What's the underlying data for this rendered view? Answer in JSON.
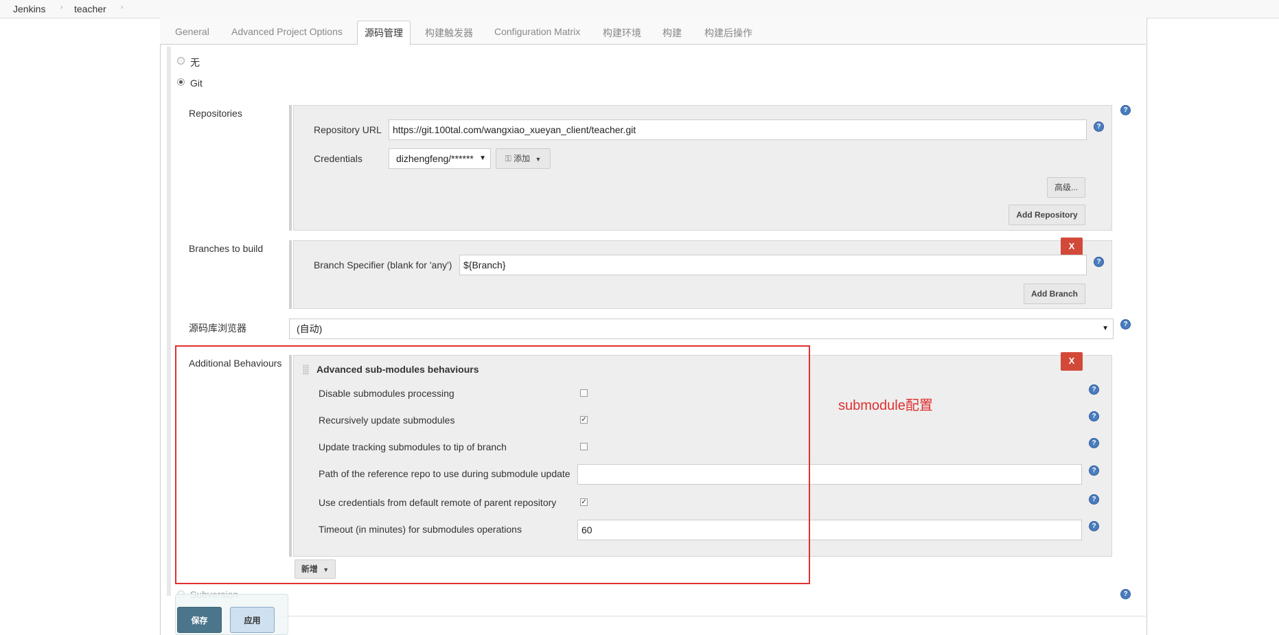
{
  "breadcrumb": [
    "Jenkins",
    "teacher"
  ],
  "tabs": [
    "General",
    "Advanced Project Options",
    "源码管理",
    "构建触发器",
    "Configuration Matrix",
    "构建环境",
    "构建",
    "构建后操作"
  ],
  "scm": {
    "option_none": "无",
    "option_git": "Git",
    "option_svn": "Subversion",
    "selected": "Git"
  },
  "repositories": {
    "label": "Repositories",
    "url_label": "Repository URL",
    "url_value": "https://git.100tal.com/wangxiao_xueyan_client/teacher.git",
    "credentials_label": "Credentials",
    "credentials_value": "dizhengfeng/******",
    "add_label": "添加",
    "advanced_label": "高级...",
    "add_repository_label": "Add Repository"
  },
  "branches": {
    "label": "Branches to build",
    "specifier_label": "Branch Specifier (blank for 'any')",
    "specifier_value": "${Branch}",
    "add_branch_label": "Add Branch",
    "delete_label": "X"
  },
  "browser": {
    "label": "源码库浏览器",
    "value": "(自动)"
  },
  "behaviours": {
    "label": "Additional Behaviours",
    "title": "Advanced sub-modules behaviours",
    "delete_label": "X",
    "disable_label": "Disable submodules processing",
    "disable_checked": false,
    "recursive_label": "Recursively update submodules",
    "recursive_checked": true,
    "tracking_label": "Update tracking submodules to tip of branch",
    "tracking_checked": false,
    "reference_label": "Path of the reference repo to use during submodule update",
    "reference_value": "",
    "parent_creds_label": "Use credentials from default remote of parent repository",
    "parent_creds_checked": true,
    "timeout_label": "Timeout (in minutes) for submodules operations",
    "timeout_value": "60",
    "add_label": "新增"
  },
  "annotation": {
    "text": "submodule配置",
    "color": "#e03030"
  },
  "footer": {
    "save_label": "保存",
    "apply_label": "应用"
  },
  "colors": {
    "delete_button": "#d24939",
    "help_icon": "#4a7cbd",
    "save_button": "#4b758b"
  }
}
